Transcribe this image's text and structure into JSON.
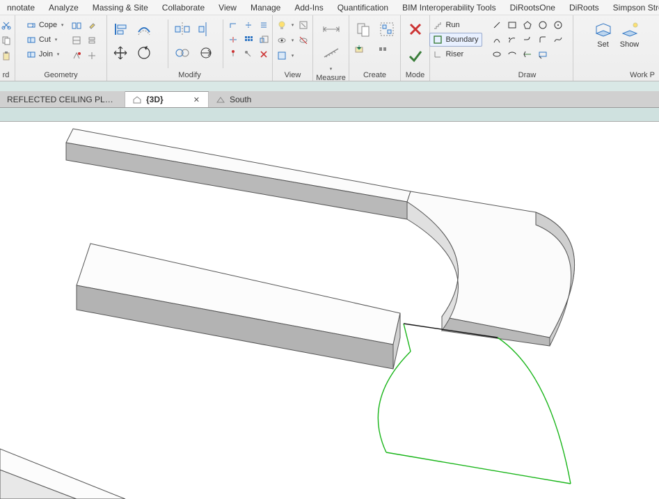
{
  "menu": [
    "nnotate",
    "Analyze",
    "Massing & Site",
    "Collaborate",
    "View",
    "Manage",
    "Add-Ins",
    "Quantification",
    "BIM Interoperability Tools",
    "DiRootsOne",
    "DiRoots",
    "Simpson Strong"
  ],
  "panels": {
    "clipboard": {
      "label": "rd"
    },
    "geometry": {
      "label": "Geometry",
      "cope": "Cope",
      "cut": "Cut",
      "join": "Join"
    },
    "modify": {
      "label": "Modify"
    },
    "view": {
      "label": "View"
    },
    "measure": {
      "label": "Measure"
    },
    "create": {
      "label": "Create"
    },
    "mode": {
      "label": "Mode"
    },
    "roof": {
      "run": "Run",
      "boundary": "Boundary",
      "riser": "Riser"
    },
    "draw": {
      "label": "Draw"
    },
    "workplane": {
      "label": "Work P",
      "set": "Set",
      "show": "Show"
    }
  },
  "tabs": {
    "rcp": "REFLECTED CEILING PLANS...",
    "v3d": "{3D}",
    "south": "South"
  }
}
